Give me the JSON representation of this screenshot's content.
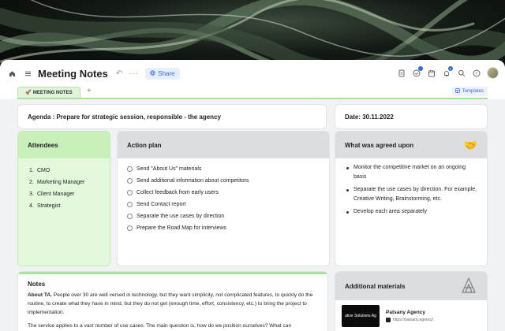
{
  "window": {
    "title": "Meeting Notes",
    "share_label": "Share",
    "notification_count": "2"
  },
  "tabs": {
    "active_label": "MEETING NOTES",
    "add_label": "+",
    "templates_label": "Templates"
  },
  "agenda": {
    "text": "Agenda : Prepare for strategic session, responsible - the agency"
  },
  "date": {
    "text": "Date: 30.11.2022"
  },
  "attendees": {
    "title": "Attendees",
    "items": [
      {
        "num": "1.",
        "name": "CMO"
      },
      {
        "num": "2.",
        "name": "Marketing Manager"
      },
      {
        "num": "3.",
        "name": "Client Manager"
      },
      {
        "num": "4.",
        "name": "Strategist"
      }
    ]
  },
  "action_plan": {
    "title": "Action plan",
    "items": [
      "Send \"About Us\" materials",
      "Send additional information about competitors",
      "Collect feedback from early users",
      "Send Contact report",
      "Separate the use cases by direction",
      "Prepare the Road Map for interviews"
    ]
  },
  "agreed": {
    "title": "What was agreed upon",
    "items": [
      "Monitor the competitive market on an ongoing basis",
      "Separate the use cases by direction. For example, Creative Writing, Brainstorming, etc.",
      "Develop each area separately"
    ]
  },
  "notes": {
    "title": "Notes",
    "p1_bold": "About TA.",
    "p1_text": " People over 30 are well versed in technology, but they want simplicity, not complicated features, to quickly do the routine, to create what they have in mind, but they do not get (enough time, effort, consistency, etc.) to bring the project to implementation.",
    "p2_text": "The service applies to a vast number of use cases. The main question is, how do we position ourselves? What can"
  },
  "materials": {
    "title": "Additional materials",
    "thumb_text": "ative Solutions Ag",
    "item_name": "Patsany Agency",
    "item_url": "https://patsany.agency/"
  },
  "colors": {
    "accent_green": "#a9e09b",
    "attendees_bg": "#e4f8dc",
    "share_blue": "#3a67d6"
  }
}
